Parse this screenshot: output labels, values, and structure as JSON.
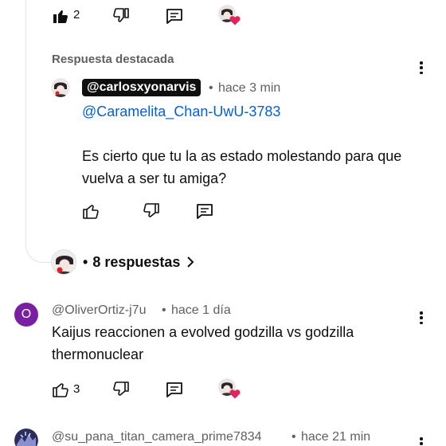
{
  "top_actions": {
    "like_count": "2"
  },
  "highlighted_reply": {
    "section_label": "Respuesta destacada",
    "author": "@carlosxyonarvis",
    "separator": "•",
    "time": "hace 3 min",
    "mention": "@Caramelita_Chan-UwU-3783",
    "text": "Es cierto que tu la as estado molestando para que vuelva a ser tu amiga?"
  },
  "replies_toggle": {
    "bullet": "•",
    "label": "8 respuestas"
  },
  "comment_1": {
    "avatar_letter": "O",
    "avatar_color": "#7b1fa2",
    "author": "@OliverOrtiz-j7u",
    "separator": "•",
    "time": "hace 1 día",
    "text": "Kaijus reaccionen a evolved godzilla vs godzilla thermonuclear",
    "like_count": "3"
  },
  "comment_2": {
    "author": "@su_pana_titan_camera_prime7834",
    "separator": "•",
    "time": "hace 21 min"
  },
  "colors": {
    "link": "#065fd4",
    "heart": "#e0245e",
    "text": "#0f0f0f",
    "muted": "#606060"
  }
}
